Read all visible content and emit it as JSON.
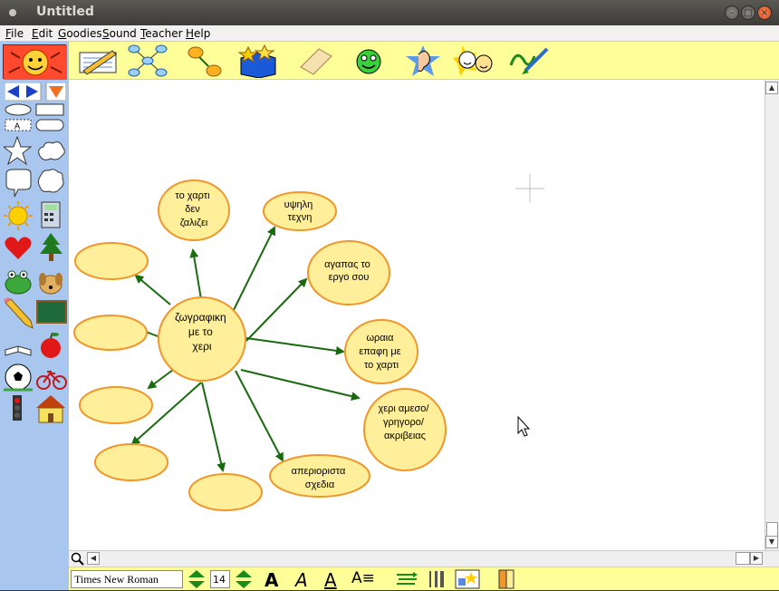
{
  "window": {
    "title": "Untitled"
  },
  "menu": [
    "File",
    "Edit",
    "Goodies",
    "Sound",
    "Teacher",
    "Help"
  ],
  "toolbar_icons": [
    "pencil-notepad-icon",
    "diagram-icon",
    "link-arrow-icon",
    "goodies-box-icon",
    "eraser-icon",
    "smiley-icon",
    "ear-icon",
    "faces-icon",
    "paintbrush-icon"
  ],
  "sidebar_icons": [
    "ellipse-shape-icon",
    "rectangle-shape-icon",
    "text-box-icon",
    "rounded-rect-icon",
    "star-shape-icon",
    "cloud-shape-icon",
    "speech-bubble-icon",
    "thought-bubble-icon",
    "sun-icon",
    "calculator-icon",
    "heart-icon",
    "tree-icon",
    "frog-icon",
    "dog-icon",
    "pencil-icon",
    "chalkboard-icon",
    "book-icon",
    "apple-icon",
    "soccer-ball-icon",
    "bicycle-icon",
    "traffic-light-icon",
    "house-icon"
  ],
  "diagram": {
    "center": {
      "lines": [
        "ζωγραφικη",
        "με το",
        "χερι"
      ]
    },
    "nodes": [
      {
        "id": "n1",
        "lines": [
          "το χαρτι",
          "δεν",
          "ζαλιζει"
        ]
      },
      {
        "id": "n2",
        "lines": [
          "υψηλη",
          "τεχνη"
        ]
      },
      {
        "id": "n3",
        "lines": [
          "αγαπας το",
          "εργο σου"
        ]
      },
      {
        "id": "n4",
        "lines": [
          "ωραια",
          "επαφη με",
          "το χαρτι"
        ]
      },
      {
        "id": "n5",
        "lines": [
          "χερι αμεσο/",
          "γρηγορο/",
          "ακριβειας"
        ]
      },
      {
        "id": "n6",
        "lines": [
          "απεριοριστα",
          "σχεδια"
        ]
      },
      {
        "id": "n7",
        "lines": []
      },
      {
        "id": "n8",
        "lines": []
      },
      {
        "id": "n9",
        "lines": []
      },
      {
        "id": "n10",
        "lines": []
      },
      {
        "id": "n11",
        "lines": []
      }
    ]
  },
  "bottom": {
    "font_name": "Times New Roman",
    "font_size": "14"
  },
  "colors": {
    "node_fill": "#ffef9a",
    "node_stroke": "#f0962a",
    "arrow": "#1a6a10",
    "toolbar": "#ffff99",
    "sidebar": "#a9c7ee"
  }
}
